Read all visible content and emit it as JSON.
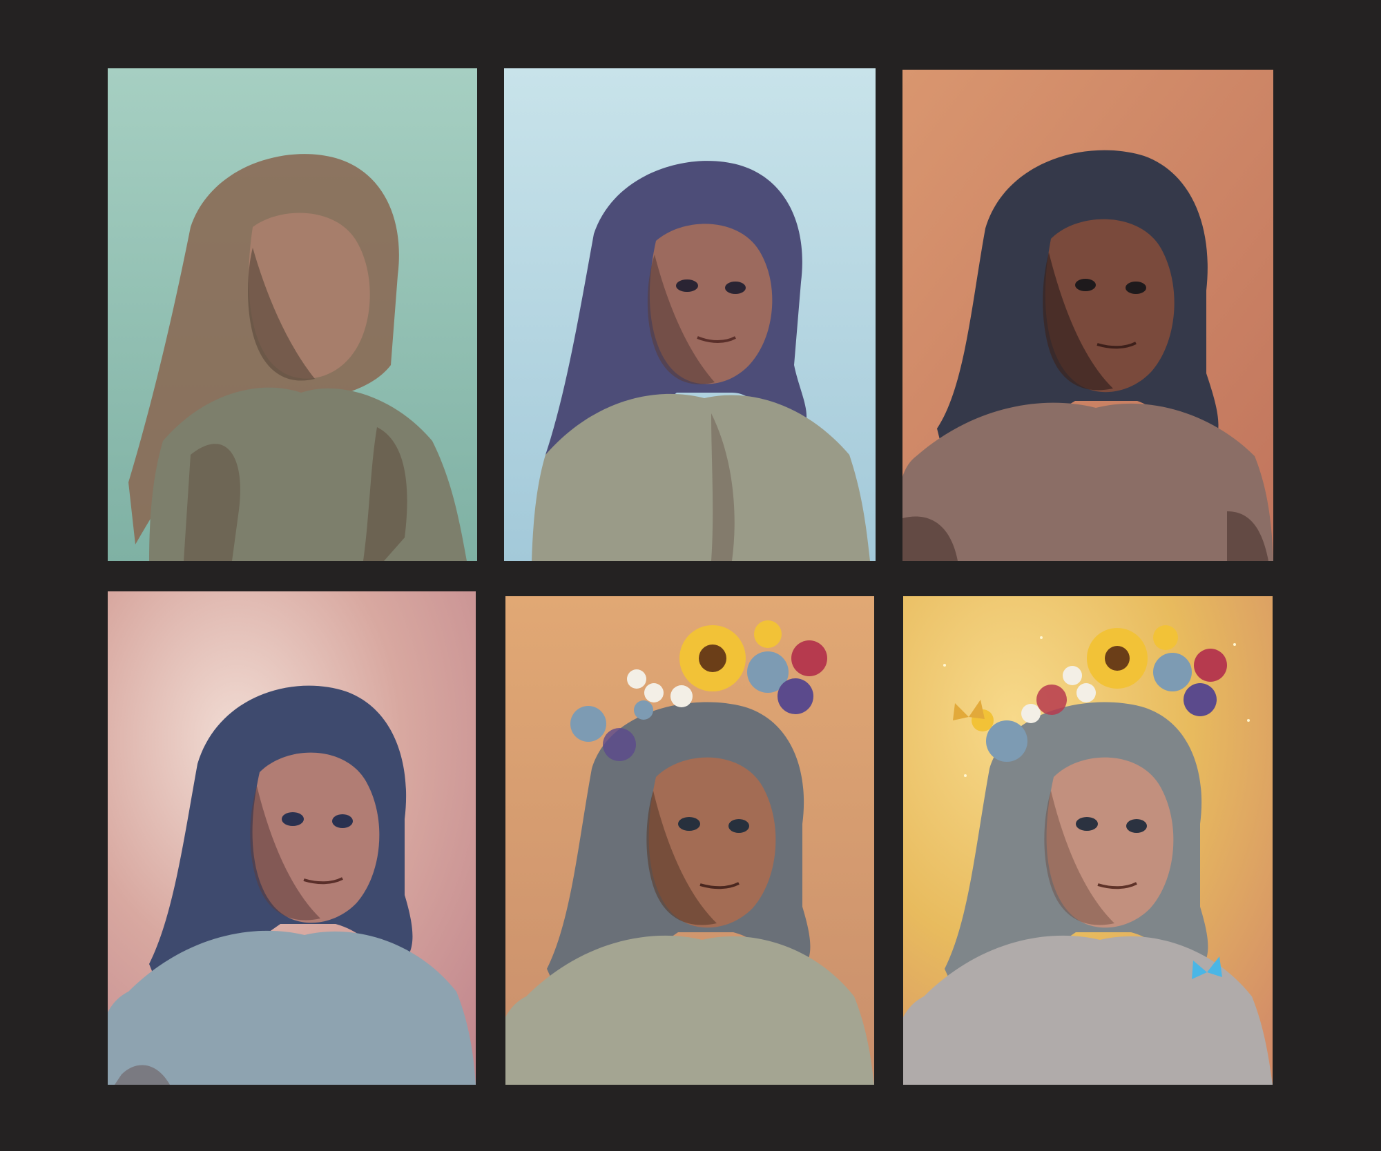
{
  "frame": {
    "background": "#242222"
  },
  "panels": [
    {
      "stage": 1,
      "bg_top": "#a6cfc2",
      "bg_bottom": "#7fb1a4",
      "hair": "#8a6a55",
      "skin": "#a77e6b",
      "shirt": "#7d7f6c",
      "shadow": "#5f4d3e"
    },
    {
      "stage": 2,
      "bg_top": "#c8e3ea",
      "bg_bottom": "#a3c9d9",
      "hair": "#4d4d78",
      "skin": "#9c6a5e",
      "shirt": "#9a9b88",
      "shadow": "#5a3e3a"
    },
    {
      "stage": 3,
      "bg_top": "#d9966f",
      "bg_bottom": "#c1755d",
      "hair": "#35394a",
      "skin": "#7a4a3c",
      "shirt": "#8b6e66",
      "shadow": "#3b2621"
    },
    {
      "stage": 4,
      "bg_top": "#d8a8a0",
      "bg_bottom": "#c2888e",
      "hair": "#3e4a6e",
      "skin": "#b17d74",
      "shirt": "#8ea3b0",
      "shadow": "#5c3c3c"
    },
    {
      "stage": 5,
      "bg_top": "#e1a874",
      "bg_bottom": "#c98f6c",
      "hair": "#6a7078",
      "skin": "#a36c54",
      "shirt": "#a4a592",
      "shadow": "#5a3a2c"
    },
    {
      "stage": 6,
      "bg_top": "#e8bb5e",
      "bg_bottom": "#d38d68",
      "hair": "#7f868a",
      "skin": "#c2907e",
      "shirt": "#b0abaa",
      "shadow": "#6c4a3e"
    }
  ],
  "flower_colors": {
    "sunflower": "#f2c237",
    "sunflower_center": "#6b3e18",
    "rose_blue": "#7d9bb3",
    "rose_red": "#b63a4e",
    "rose_purple": "#5b4a8c",
    "daisy": "#f3efe6",
    "butterfly_yellow": "#e2a93a",
    "butterfly_blue": "#4ab6e6"
  }
}
